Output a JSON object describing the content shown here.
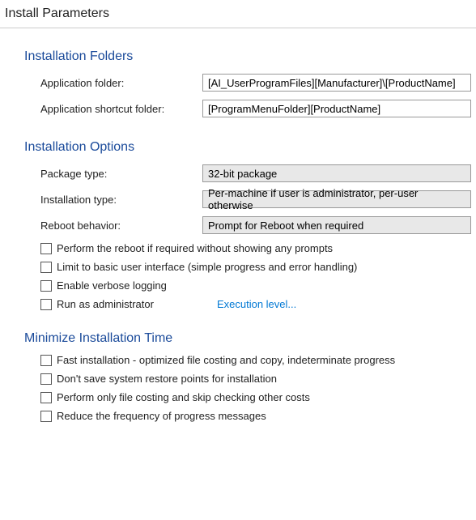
{
  "header": {
    "title": "Install Parameters"
  },
  "sections": {
    "folders": {
      "title": "Installation Folders",
      "app_folder_label": "Application folder:",
      "app_folder_value": "[AI_UserProgramFiles][Manufacturer]\\[ProductName]",
      "shortcut_folder_label": "Application shortcut folder:",
      "shortcut_folder_value": "[ProgramMenuFolder][ProductName]"
    },
    "options": {
      "title": "Installation Options",
      "package_type_label": "Package type:",
      "package_type_value": "32-bit package",
      "install_type_label": "Installation type:",
      "install_type_value": "Per-machine if user is administrator, per-user otherwise",
      "reboot_label": "Reboot behavior:",
      "reboot_value": "Prompt for Reboot when required",
      "cb_reboot_silent": "Perform the reboot if required without showing any prompts",
      "cb_basic_ui": "Limit to basic user interface (simple progress and error handling)",
      "cb_verbose": "Enable verbose logging",
      "cb_run_admin": "Run as administrator",
      "exec_level_link": "Execution level..."
    },
    "minimize": {
      "title": "Minimize Installation Time",
      "cb_fast_install": "Fast installation - optimized file costing and copy, indeterminate progress",
      "cb_no_restore": "Don't save system restore points for installation",
      "cb_file_costing": "Perform only file costing and skip checking other costs",
      "cb_reduce_progress": "Reduce the frequency of progress messages"
    }
  }
}
